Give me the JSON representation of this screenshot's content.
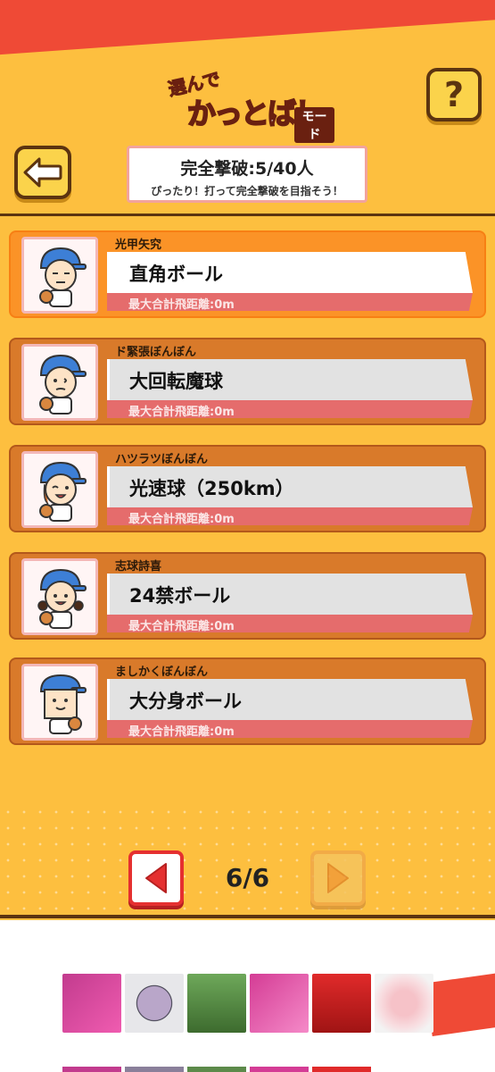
{
  "header": {
    "logo_small": "選んで",
    "logo_big": "かっとばし",
    "logo_mode": "モード",
    "help_label": "?",
    "status_title": "完全撃破:5/40人",
    "status_sub": "ぴったり！打って完全撃破を目指そう！"
  },
  "cards": [
    {
      "character": "光甲矢究",
      "ball": "直角ボール",
      "distance": "最大合計飛距離:0m",
      "selected": true
    },
    {
      "character": "ド緊張ぼんぼん",
      "ball": "大回転魔球",
      "distance": "最大合計飛距離:0m",
      "selected": false
    },
    {
      "character": "ハツラツぼんぼん",
      "ball": "光速球（250km）",
      "distance": "最大合計飛距離:0m",
      "selected": false
    },
    {
      "character": "志球詩喜",
      "ball": "24禁ボール",
      "distance": "最大合計飛距離:0m",
      "selected": false
    },
    {
      "character": "ましかくぼんぼん",
      "ball": "大分身ボール",
      "distance": "最大合計飛距離:0m",
      "selected": false
    }
  ],
  "pager": {
    "indicator": "6/6"
  },
  "icons": {
    "back": "back-arrow-icon",
    "help": "question-icon",
    "prev": "triangle-left-icon",
    "next": "triangle-right-icon"
  },
  "colors": {
    "background": "#fdbf3f",
    "accent_red": "#ef4a36",
    "card": "#d97a2a",
    "card_selected": "#fb9327",
    "distance_bar": "#e56c6c",
    "outline": "#5c3410"
  }
}
